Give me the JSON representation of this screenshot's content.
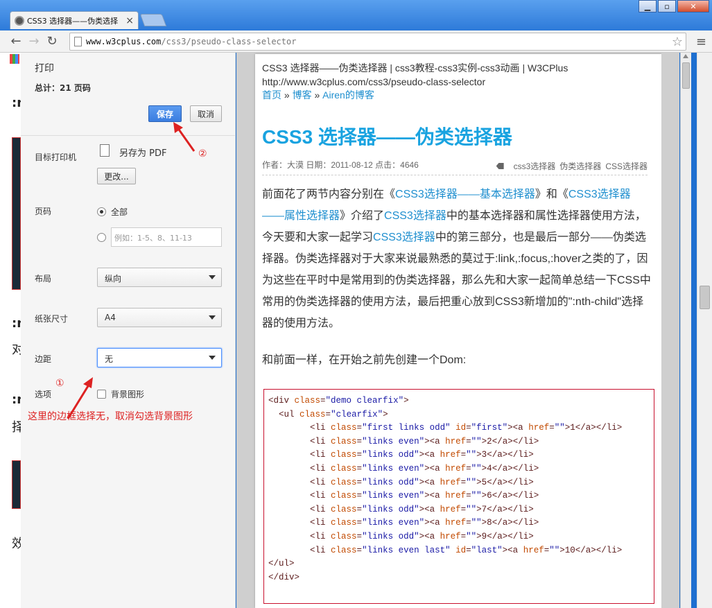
{
  "browser": {
    "tab_title": "CSS3 选择器——伪类选择",
    "tab_close": "×",
    "window_buttons": {
      "minimize": "▁",
      "maximize": "▫",
      "close": "✕"
    },
    "nav": {
      "back": "←",
      "forward": "→",
      "reload": "↻"
    },
    "url_host": "www.w3cplus.com",
    "url_path": "/css3/pseudo-class-selector",
    "star": "☆",
    "menu": "≡"
  },
  "background_page": {
    "fragments": [
      ":n",
      ":n",
      "对",
      ":n",
      "择",
      "效"
    ]
  },
  "print": {
    "title": "打印",
    "total": "总计：21 页码",
    "save_label": "保存",
    "cancel_label": "取消",
    "destination_label": "目标打印机",
    "destination_value": "另存为 PDF",
    "change_label": "更改...",
    "pages_label": "页码",
    "pages_all": "全部",
    "pages_placeholder": "例如：1-5、8、11-13",
    "layout_label": "布局",
    "layout_value": "纵向",
    "paper_label": "纸张尺寸",
    "paper_value": "A4",
    "margin_label": "边距",
    "margin_value": "无",
    "options_label": "选项",
    "background_graphics_label": "背景图形"
  },
  "annotations": {
    "marker_1": "①",
    "marker_2": "②",
    "note": "这里的边框选择无，取消勾选背景图形",
    "color": "#dd2222"
  },
  "preview": {
    "header_title": "CSS3 选择器——伪类选择器 | css3教程-css3实例-css3动画 | W3CPlus",
    "header_url": "http://www.w3cplus.com/css3/pseudo-class-selector",
    "breadcrumb": [
      "首页",
      "博客",
      "Airen的博客"
    ],
    "breadcrumb_sep": "»",
    "title": "CSS3 选择器——伪类选择器",
    "meta": "作者：大漠 日期：2011-08-12 点击：4646",
    "tags": [
      "css3选择器",
      "伪类选择器",
      "CSS选择器"
    ],
    "para1": [
      {
        "t": "前面花了两节内容分别在《"
      },
      {
        "t": "CSS3选择器——基本选择器",
        "link": true
      },
      {
        "t": "》和《"
      },
      {
        "t": "CSS3选择器——属性选择器",
        "link": true
      },
      {
        "t": "》介绍了"
      },
      {
        "t": "CSS3选择器",
        "link": true
      },
      {
        "t": "中的基本选择器和属性选择器使用方法，今天要和大家一起学习"
      },
      {
        "t": "CSS3选择器",
        "link": true
      },
      {
        "t": "中的第三部分，也是最后一部分——伪类选择器。伪类选择器对于大家来说最熟悉的莫过于:link,:focus,:hover之类的了，因为这些在平时中是常用到的伪类选择器，那么先和大家一起简单总结一下CSS中常用的伪类选择器的使用方法，最后把重心放到CSS3新增加的\":nth-child\"选择器的使用方法。"
      }
    ],
    "para2": "和前面一样，在开始之前先创建一个Dom:",
    "code_lines": [
      {
        "indent": "",
        "tag": "div",
        "cls": "demo clearfix",
        "id": null,
        "inner": null
      },
      {
        "indent": "  ",
        "tag": "ul",
        "cls": "clearfix",
        "id": null,
        "inner": null
      },
      {
        "indent": "        ",
        "tag": "li",
        "cls": "first links odd",
        "id": "first",
        "inner": "1"
      },
      {
        "indent": "        ",
        "tag": "li",
        "cls": "links even",
        "id": null,
        "inner": "2"
      },
      {
        "indent": "        ",
        "tag": "li",
        "cls": "links odd",
        "id": null,
        "inner": "3"
      },
      {
        "indent": "        ",
        "tag": "li",
        "cls": "links even",
        "id": null,
        "inner": "4"
      },
      {
        "indent": "        ",
        "tag": "li",
        "cls": "links odd",
        "id": null,
        "inner": "5"
      },
      {
        "indent": "        ",
        "tag": "li",
        "cls": "links even",
        "id": null,
        "inner": "6"
      },
      {
        "indent": "        ",
        "tag": "li",
        "cls": "links odd",
        "id": null,
        "inner": "7"
      },
      {
        "indent": "        ",
        "tag": "li",
        "cls": "links even",
        "id": null,
        "inner": "8"
      },
      {
        "indent": "        ",
        "tag": "li",
        "cls": "links odd",
        "id": null,
        "inner": "9"
      },
      {
        "indent": "        ",
        "tag": "li",
        "cls": "links even last",
        "id": "last",
        "inner": "10"
      },
      {
        "indent": "",
        "close": "ul"
      },
      {
        "indent": "",
        "close": "div"
      }
    ]
  }
}
